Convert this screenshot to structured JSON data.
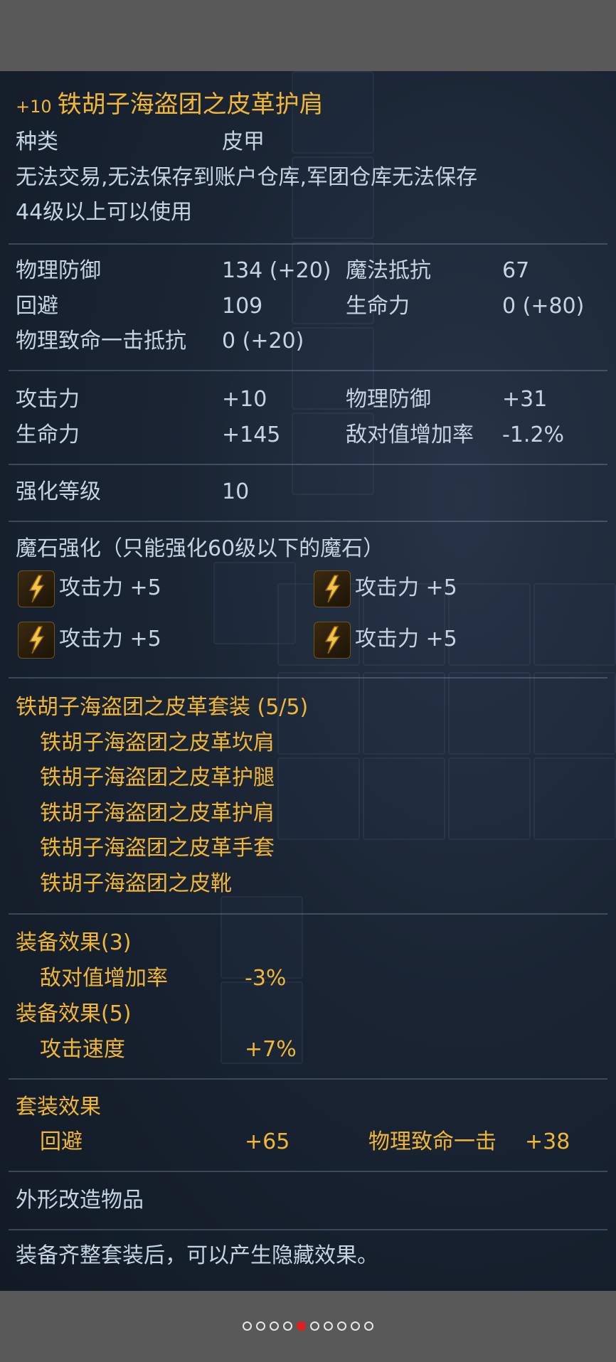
{
  "item": {
    "enhance": "+10",
    "name": "铁胡子海盗团之皮革护肩",
    "category_label": "种类",
    "category_value": "皮甲",
    "restriction": "无法交易,无法保存到账户仓库,军团仓库无法保存",
    "level_req": "44级以上可以使用"
  },
  "base_stats": [
    {
      "label": "物理防御",
      "value": "134 (+20)"
    },
    {
      "label": "魔法抵抗",
      "value": "67"
    },
    {
      "label": "回避",
      "value": "109"
    },
    {
      "label": "生命力",
      "value": "0 (+80)"
    },
    {
      "label": "物理致命一击抵抗",
      "value": "0 (+20)"
    }
  ],
  "bonus_stats": [
    {
      "label": "攻击力",
      "value": "+10"
    },
    {
      "label": "物理防御",
      "value": "+31"
    },
    {
      "label": "生命力",
      "value": "+145"
    },
    {
      "label": "敌对值增加率",
      "value": "-1.2%"
    }
  ],
  "enhance_level": {
    "label": "强化等级",
    "value": "10"
  },
  "manastone": {
    "header": "魔石强化（只能强化60级以下的魔石）",
    "slots": [
      {
        "label": "攻击力 +5",
        "icon": "manastone-icon"
      },
      {
        "label": "攻击力 +5",
        "icon": "manastone-icon"
      },
      {
        "label": "攻击力 +5",
        "icon": "manastone-icon"
      },
      {
        "label": "攻击力 +5",
        "icon": "manastone-icon"
      }
    ]
  },
  "set": {
    "header": "铁胡子海盗团之皮革套装 (5/5)",
    "pieces": [
      "铁胡子海盗团之皮革坎肩",
      "铁胡子海盗团之皮革护腿",
      "铁胡子海盗团之皮革护肩",
      "铁胡子海盗团之皮革手套",
      "铁胡子海盗团之皮靴"
    ]
  },
  "equip_effects": [
    {
      "header": "装备效果(3)",
      "stat": "敌对值增加率",
      "value": "-3%"
    },
    {
      "header": "装备效果(5)",
      "stat": "攻击速度",
      "value": "+7%"
    }
  ],
  "set_effect": {
    "header": "套装效果",
    "stats": [
      {
        "label": "回避",
        "value": "+65"
      },
      {
        "label": "物理致命一击",
        "value": "+38"
      }
    ]
  },
  "appearance": "外形改造物品",
  "note": "装备齐整套装后，可以产生隐藏效果。",
  "pager": {
    "total": 10,
    "active": 4
  },
  "colors": {
    "gold": "#f0b63a",
    "text": "#c6d3e2",
    "panel": "#1a2433",
    "active_dot": "#e02020"
  }
}
